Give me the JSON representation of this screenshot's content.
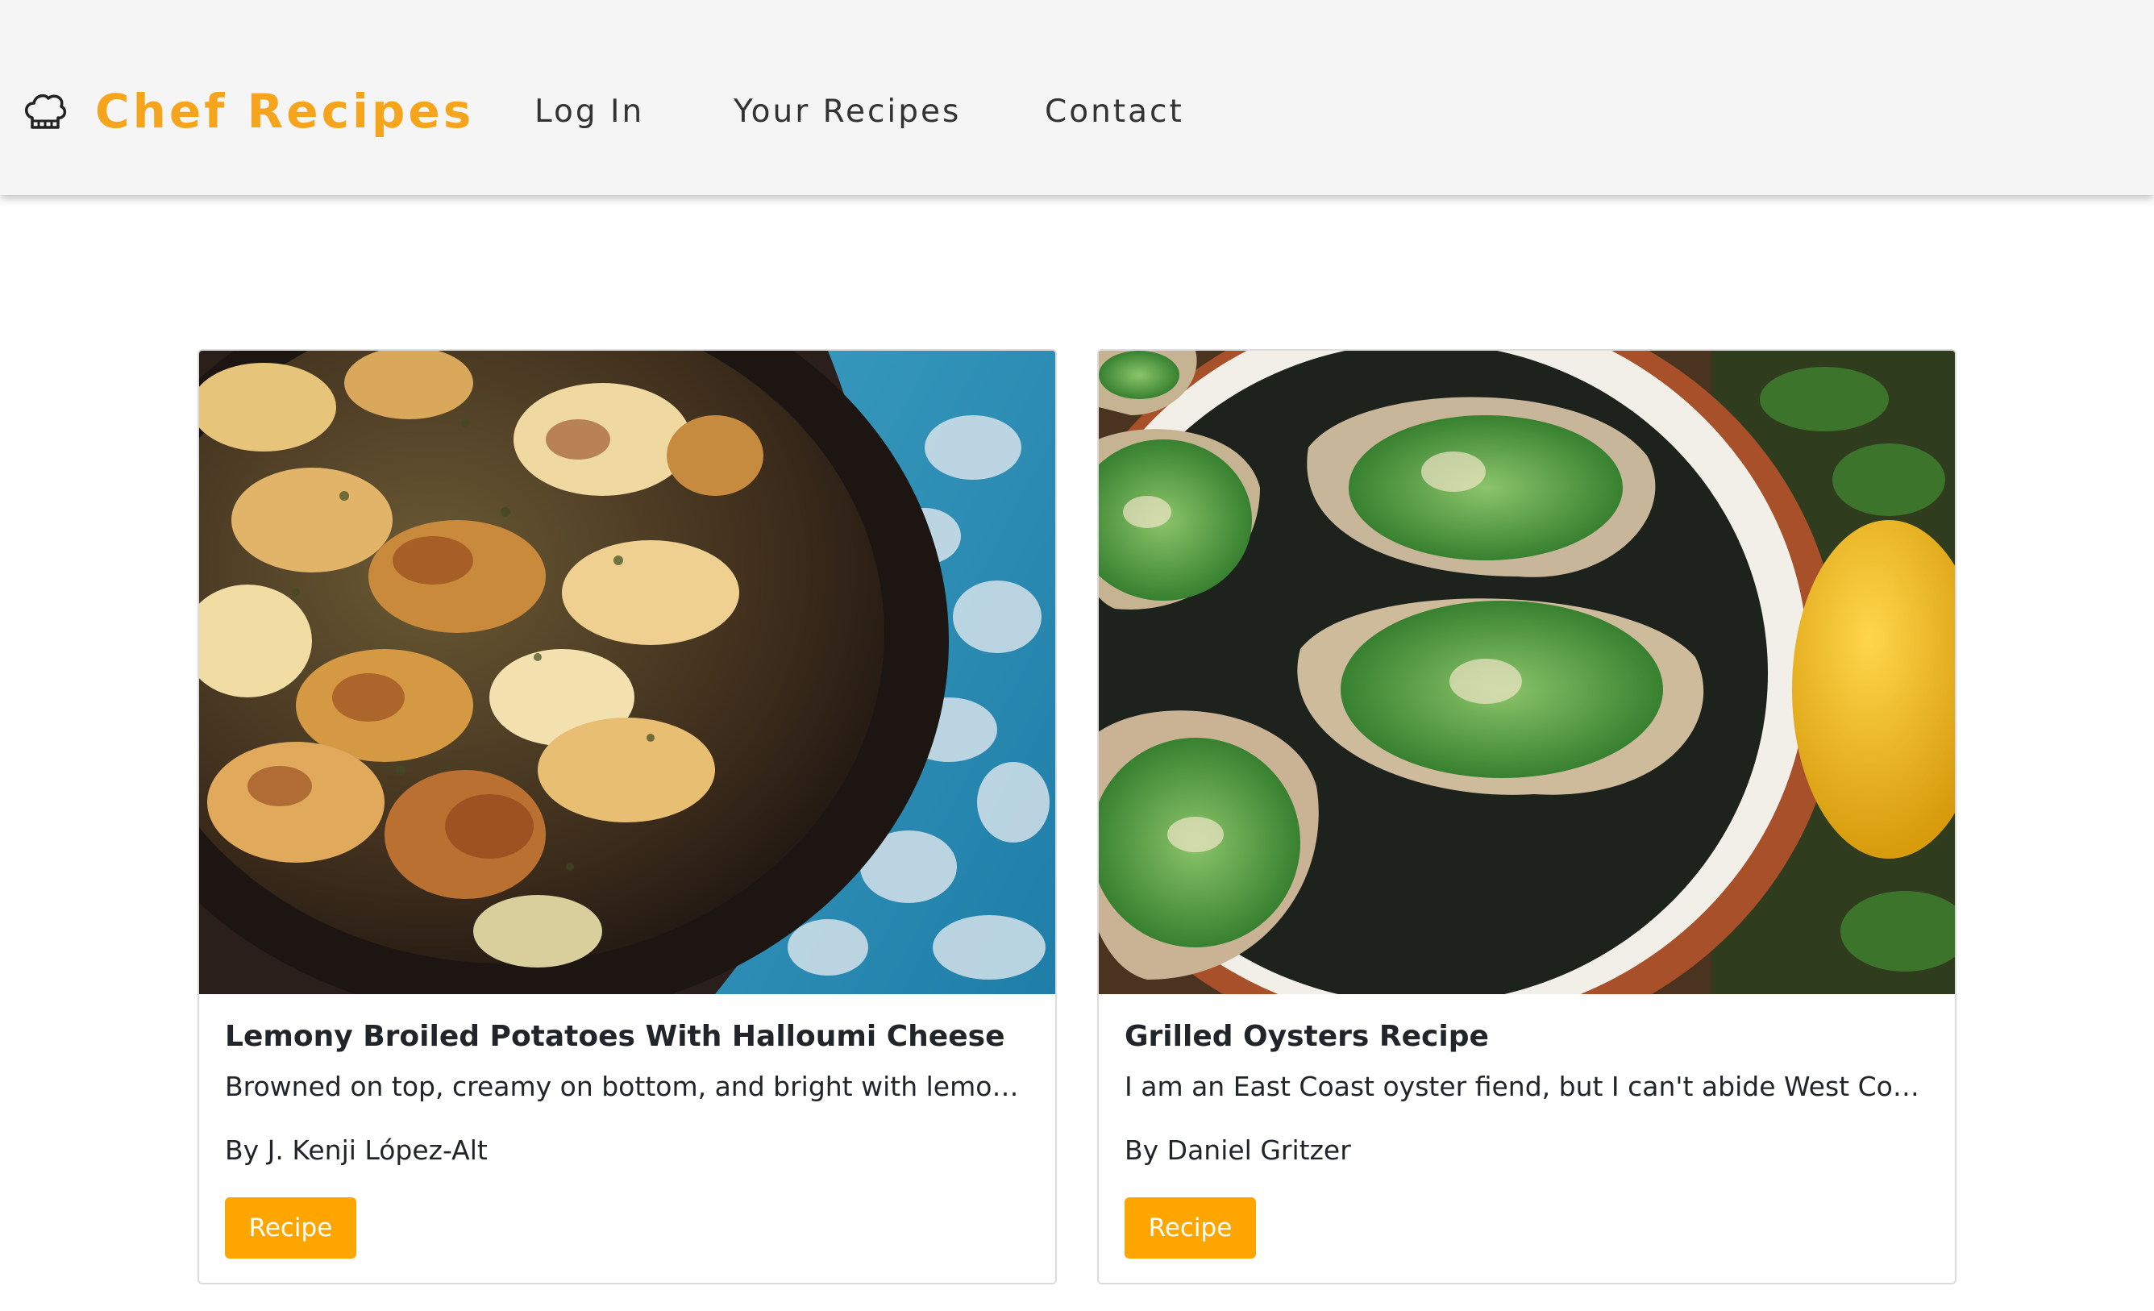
{
  "brand": {
    "icon": "chef-hat-icon",
    "name": "Chef Recipes",
    "accent_color": "#f7a41d"
  },
  "nav": {
    "items": [
      {
        "label": "Log In"
      },
      {
        "label": "Your Recipes"
      },
      {
        "label": "Contact"
      }
    ]
  },
  "recipes": [
    {
      "title": "Lemony Broiled Potatoes With Halloumi Cheese",
      "description": "Browned on top, creamy on bottom, and bright with lemon, t...",
      "author": "By J. Kenji López-Alt",
      "button_label": "Recipe",
      "image": "photo of broiled potatoes with halloumi in a cast-iron skillet"
    },
    {
      "title": "Grilled Oysters Recipe",
      "description": "I am an East Coast oyster fiend, but I can't abide West Coast ...",
      "author": "By Daniel Gritzer",
      "button_label": "Recipe",
      "image": "photo of grilled oysters with herb butter and a lemon"
    }
  ],
  "colors": {
    "button": "#ffa500",
    "navbar_bg": "#f5f5f5"
  }
}
